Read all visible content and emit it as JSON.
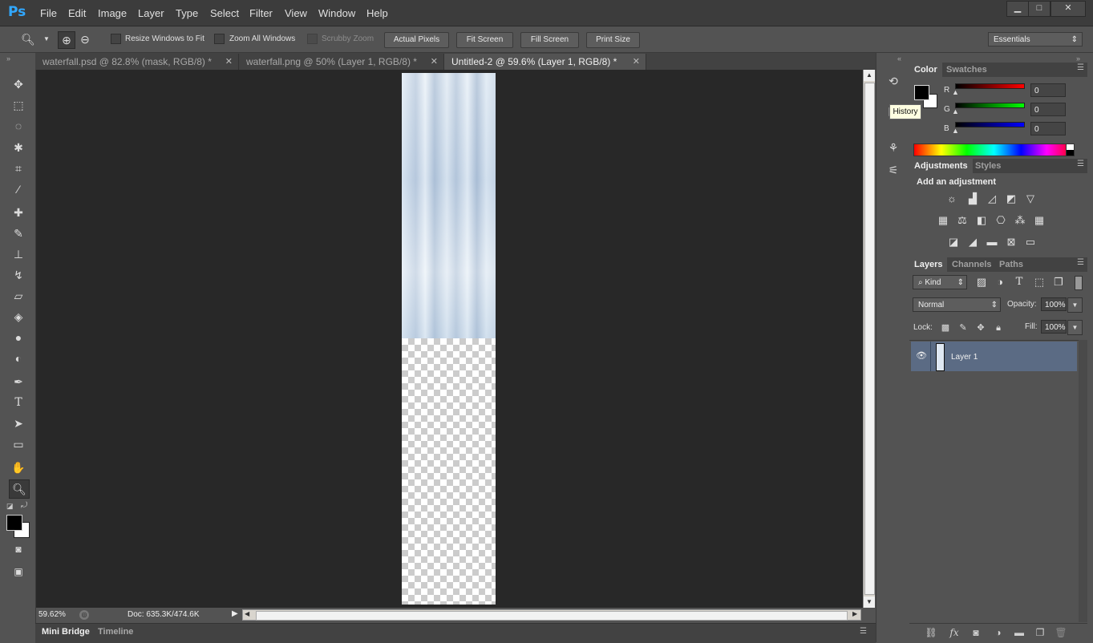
{
  "app": {
    "logo": "Ps",
    "menu": [
      "File",
      "Edit",
      "Image",
      "Layer",
      "Type",
      "Select",
      "Filter",
      "View",
      "Window",
      "Help"
    ],
    "window_controls": {
      "minimize": "▁",
      "maximize": "□",
      "close": "✕"
    }
  },
  "options_bar": {
    "tool_icon": "zoom-icon",
    "resize_windows_label": "Resize Windows to Fit",
    "zoom_all_label": "Zoom All Windows",
    "scrubby_zoom_label": "Scrubby Zoom",
    "actual_pixels": "Actual Pixels",
    "fit_screen": "Fit Screen",
    "fill_screen": "Fill Screen",
    "print_size": "Print Size",
    "workspace": "Essentials"
  },
  "tabs": [
    {
      "label": "waterfall.psd @ 82.8% (mask, RGB/8) *",
      "active": false
    },
    {
      "label": "waterfall.png @ 50% (Layer 1, RGB/8) *",
      "active": false
    },
    {
      "label": "Untitled-2 @ 59.6% (Layer 1, RGB/8) *",
      "active": true
    }
  ],
  "status_bar": {
    "zoom": "59.62%",
    "doc_info": "Doc: 635.3K/474.6K"
  },
  "bottom_tabs": [
    "Mini Bridge",
    "Timeline"
  ],
  "tooltip": "History",
  "color_panel": {
    "tabs": [
      "Color",
      "Swatches"
    ],
    "channels": [
      {
        "label": "R",
        "value": "0",
        "color": "#ff0000"
      },
      {
        "label": "G",
        "value": "0",
        "color": "#00ff00"
      },
      {
        "label": "B",
        "value": "0",
        "color": "#0000ff"
      }
    ],
    "foreground": "#000000",
    "background": "#ffffff"
  },
  "adjustments_panel": {
    "tabs": [
      "Adjustments",
      "Styles"
    ],
    "heading": "Add an adjustment"
  },
  "layers_panel": {
    "tabs": [
      "Layers",
      "Channels",
      "Paths"
    ],
    "filter_kind": "Kind",
    "blend_mode": "Normal",
    "opacity_label": "Opacity:",
    "opacity_value": "100%",
    "lock_label": "Lock:",
    "fill_label": "Fill:",
    "fill_value": "100%",
    "layers": [
      {
        "name": "Layer 1",
        "visible": true,
        "selected": true
      }
    ]
  }
}
